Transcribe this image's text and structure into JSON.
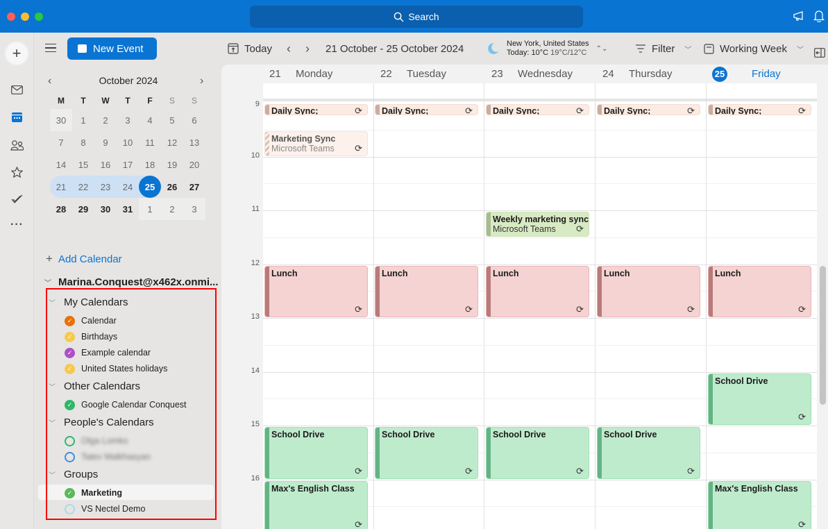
{
  "titlebar": {
    "search_label": "Search",
    "icons": [
      "search-icon",
      "megaphone-icon",
      "bell-icon"
    ]
  },
  "rail": {
    "items": [
      "compose-icon",
      "mail-icon",
      "calendar-icon",
      "people-icon",
      "favorites-icon",
      "todo-icon",
      "more-icon"
    ],
    "active": "calendar-icon"
  },
  "sidebar": {
    "new_event_label": "New Event",
    "mini_calendar": {
      "title": "October 2024",
      "weekday_headers": [
        "M",
        "T",
        "W",
        "T",
        "F",
        "S",
        "S"
      ],
      "weeks": [
        [
          "30",
          "1",
          "2",
          "3",
          "4",
          "5",
          "6"
        ],
        [
          "7",
          "8",
          "9",
          "10",
          "11",
          "12",
          "13"
        ],
        [
          "14",
          "15",
          "16",
          "17",
          "18",
          "19",
          "20"
        ],
        [
          "21",
          "22",
          "23",
          "24",
          "25",
          "26",
          "27"
        ],
        [
          "28",
          "29",
          "30",
          "31",
          "1",
          "2",
          "3"
        ]
      ],
      "today": "25",
      "selected_week": "21-25"
    },
    "add_calendar_label": "Add Calendar",
    "account": "Marina.Conquest@x462x.onmi...",
    "sections": [
      {
        "title": "My Calendars",
        "items": [
          {
            "name": "Calendar",
            "color": "#e8710a",
            "checked": true
          },
          {
            "name": "Birthdays",
            "color": "#f6c94f",
            "checked": true
          },
          {
            "name": "Example calendar",
            "color": "#b04fc5",
            "checked": true
          },
          {
            "name": "United States holidays",
            "color": "#f6c94f",
            "checked": true
          }
        ]
      },
      {
        "title": "Other Calendars",
        "items": [
          {
            "name": "Google Calendar Conquest",
            "color": "#2fb769",
            "checked": true
          }
        ]
      },
      {
        "title": "People's Calendars",
        "items": [
          {
            "name": "Olga Lomko",
            "color": "#2fb769",
            "checked": false
          },
          {
            "name": "Tatev Malkhasyan",
            "color": "#3b8fe0",
            "checked": false
          }
        ]
      },
      {
        "title": "Groups",
        "items": [
          {
            "name": "Marketing",
            "color": "#5cb85c",
            "checked": true
          },
          {
            "name": "VS Nectel Demo",
            "color": "#a9dbe8",
            "checked": false
          }
        ]
      }
    ]
  },
  "toolbar": {
    "today_label": "Today",
    "date_range": "21 October - 25 October 2024",
    "weather_location": "New York, United States",
    "weather_today": "Today: 10°C",
    "weather_range": "19°C/12°C",
    "filter_label": "Filter",
    "view_label": "Working Week"
  },
  "calendar": {
    "days": [
      {
        "num": "21",
        "name": "Monday"
      },
      {
        "num": "22",
        "name": "Tuesday"
      },
      {
        "num": "23",
        "name": "Wednesday"
      },
      {
        "num": "24",
        "name": "Thursday"
      },
      {
        "num": "25",
        "name": "Friday",
        "today": true
      }
    ],
    "hours": [
      "9",
      "10",
      "11",
      "12",
      "13",
      "14",
      "15",
      "16"
    ],
    "events": [
      {
        "day": 0,
        "title": "Daily Sync;",
        "type": "sync",
        "start": 9.0,
        "end": 9.25,
        "recurring": true
      },
      {
        "day": 1,
        "title": "Daily Sync;",
        "type": "sync",
        "start": 9.0,
        "end": 9.25,
        "recurring": true
      },
      {
        "day": 2,
        "title": "Daily Sync;",
        "type": "sync",
        "start": 9.0,
        "end": 9.25,
        "recurring": true
      },
      {
        "day": 3,
        "title": "Daily Sync;",
        "type": "sync",
        "start": 9.0,
        "end": 9.25,
        "recurring": true
      },
      {
        "day": 4,
        "title": "Daily Sync;",
        "type": "sync",
        "start": 9.0,
        "end": 9.25,
        "recurring": true
      },
      {
        "day": 0,
        "title": "Marketing Sync",
        "subtitle": "Microsoft Teams",
        "type": "mkt",
        "start": 9.5,
        "end": 10.0,
        "recurring": true
      },
      {
        "day": 2,
        "title": "Weekly marketing sync",
        "subtitle": "Microsoft Teams",
        "type": "weekly",
        "start": 11.0,
        "end": 11.5,
        "recurring": true
      },
      {
        "day": 0,
        "title": "Lunch",
        "type": "lunch",
        "start": 12.0,
        "end": 13.0,
        "recurring": true
      },
      {
        "day": 1,
        "title": "Lunch",
        "type": "lunch",
        "start": 12.0,
        "end": 13.0,
        "recurring": true
      },
      {
        "day": 2,
        "title": "Lunch",
        "type": "lunch",
        "start": 12.0,
        "end": 13.0,
        "recurring": true
      },
      {
        "day": 3,
        "title": "Lunch",
        "type": "lunch",
        "start": 12.0,
        "end": 13.0,
        "recurring": true
      },
      {
        "day": 4,
        "title": "Lunch",
        "type": "lunch",
        "start": 12.0,
        "end": 13.0,
        "recurring": true
      },
      {
        "day": 4,
        "title": "School Drive",
        "type": "green",
        "start": 14.0,
        "end": 15.0,
        "recurring": true
      },
      {
        "day": 0,
        "title": "School Drive",
        "type": "green",
        "start": 15.0,
        "end": 16.0,
        "recurring": true
      },
      {
        "day": 1,
        "title": "School Drive",
        "type": "green",
        "start": 15.0,
        "end": 16.0,
        "recurring": true
      },
      {
        "day": 2,
        "title": "School Drive",
        "type": "green",
        "start": 15.0,
        "end": 16.0,
        "recurring": true
      },
      {
        "day": 3,
        "title": "School Drive",
        "type": "green",
        "start": 15.0,
        "end": 16.0,
        "recurring": true
      },
      {
        "day": 0,
        "title": "Max's English Class",
        "type": "green",
        "start": 16.0,
        "end": 17.0,
        "recurring": true
      },
      {
        "day": 4,
        "title": "Max's English Class",
        "type": "green",
        "start": 16.0,
        "end": 17.0,
        "recurring": true
      }
    ]
  }
}
